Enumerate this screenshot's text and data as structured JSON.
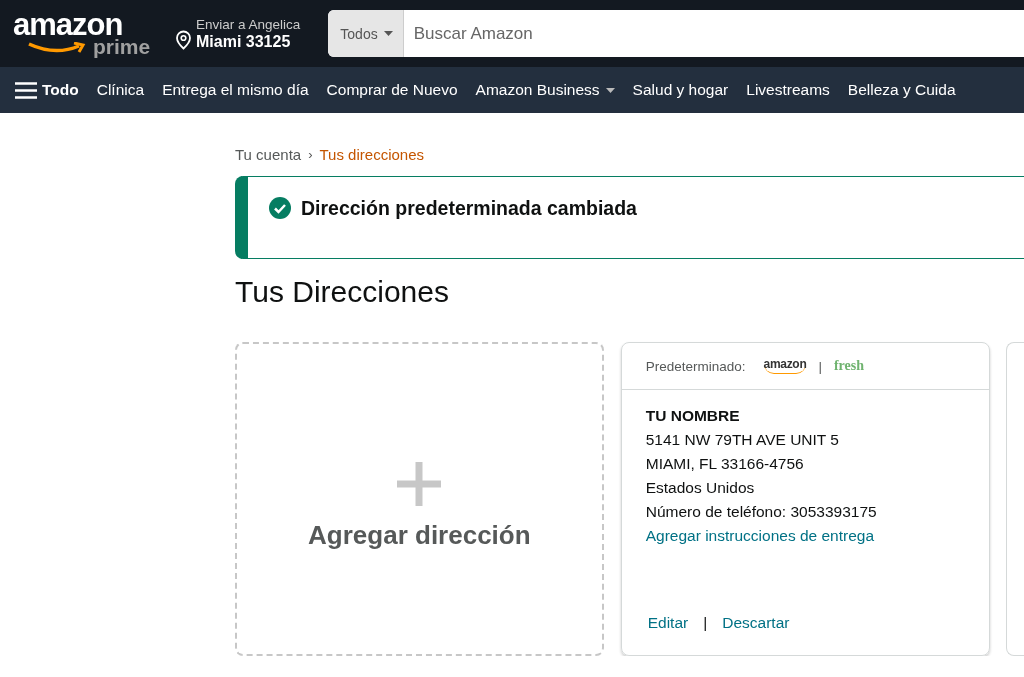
{
  "header": {
    "logo": "amazon",
    "logo_sub": "prime",
    "deliver_label": "Enviar a Angelica",
    "deliver_location": "Miami 33125",
    "search_category": "Todos",
    "search_placeholder": "Buscar Amazon"
  },
  "nav": {
    "menu_label": "Todo",
    "items": [
      {
        "label": "Clínica",
        "dropdown": false
      },
      {
        "label": "Entrega el mismo día",
        "dropdown": false
      },
      {
        "label": "Comprar de Nuevo",
        "dropdown": false
      },
      {
        "label": "Amazon Business",
        "dropdown": true
      },
      {
        "label": "Salud y hogar",
        "dropdown": false
      },
      {
        "label": "Livestreams",
        "dropdown": false
      },
      {
        "label": "Belleza y Cuida",
        "dropdown": false
      }
    ]
  },
  "breadcrumb": [
    {
      "label": "Tu cuenta",
      "current": false
    },
    {
      "label": "Tus direcciones",
      "current": true
    }
  ],
  "breadcrumb_separator": "›",
  "alert": {
    "message": "Dirección predeterminada cambiada"
  },
  "page_title": "Tus Direcciones",
  "add_card": {
    "label": "Agregar dirección"
  },
  "address_card": {
    "default_label": "Predeterminado:",
    "default_brands": [
      "amazon",
      "fresh"
    ],
    "brand_separator": "|",
    "action_separator": "|",
    "name": "TU NOMBRE",
    "lines": [
      "5141 NW 79TH AVE UNIT 5",
      "MIAMI, FL 33166-4756",
      "Estados Unidos",
      "Número de teléfono: 3053393175"
    ],
    "instructions_link": "Agregar instrucciones de entrega",
    "actions": [
      "Editar",
      "Descartar"
    ]
  }
}
